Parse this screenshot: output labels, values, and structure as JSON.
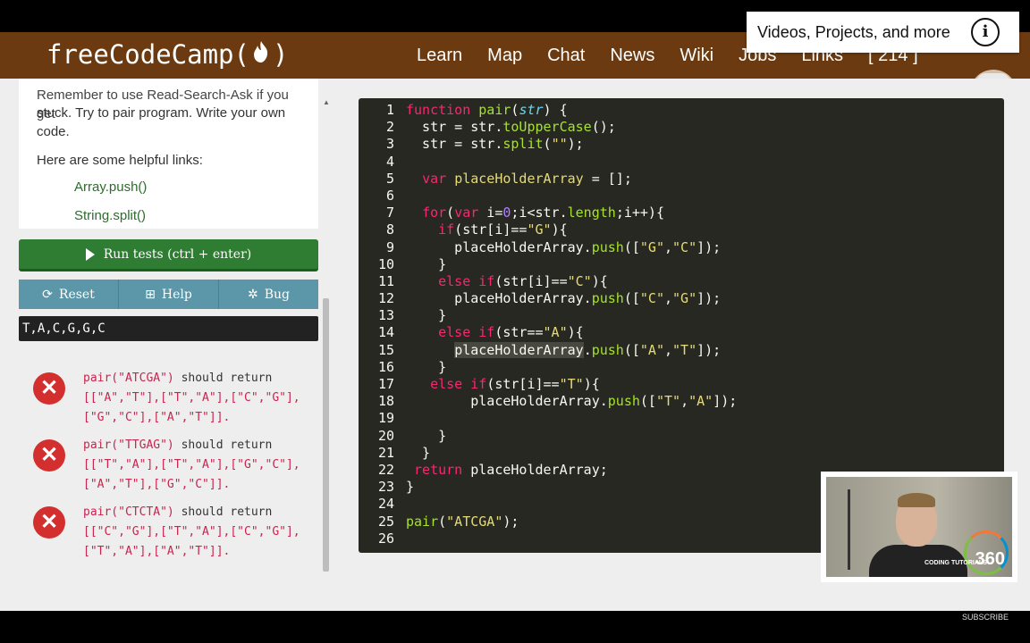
{
  "navbar": {
    "brand": "freeCodeCamp(",
    "brand_close": ")",
    "links": [
      "Learn",
      "Map",
      "Chat",
      "News",
      "Wiki",
      "Jobs",
      "Links",
      "[ 214 ]"
    ]
  },
  "overlay": {
    "text": "Videos, Projects, and more",
    "info_icon": "i"
  },
  "description": {
    "partial_top": "Remember to use Read-Search-Ask if you get",
    "line1": "stuck. Try to pair program. Write your own",
    "line2": "code.",
    "helpful": "Here are some helpful links:",
    "links": [
      "Array.push()",
      "String.split()"
    ]
  },
  "buttons": {
    "run": "Run tests (ctrl + enter)",
    "reset": "Reset",
    "help": "Help",
    "bug": "Bug"
  },
  "output": "T,A,C,G,G,C",
  "tests": [
    {
      "call": "pair(\"ATCGA\")",
      "text": " should return",
      "line2": "[[\"A\",\"T\"],[\"T\",\"A\"],[\"C\",\"G\"],",
      "line3": "[\"G\",\"C\"],[\"A\",\"T\"]]."
    },
    {
      "call": "pair(\"TTGAG\")",
      "text": " should return",
      "line2": "[[\"T\",\"A\"],[\"T\",\"A\"],[\"G\",\"C\"],",
      "line3": "[\"A\",\"T\"],[\"G\",\"C\"]]."
    },
    {
      "call": "pair(\"CTCTA\")",
      "text": " should return",
      "line2": "[[\"C\",\"G\"],[\"T\",\"A\"],[\"C\",\"G\"],",
      "line3": "[\"T\",\"A\"],[\"A\",\"T\"]]."
    }
  ],
  "line_numbers": [
    "1",
    "2",
    "3",
    "4",
    "5",
    "6",
    "7",
    "8",
    "9",
    "10",
    "11",
    "12",
    "13",
    "14",
    "15",
    "16",
    "17",
    "18",
    "19",
    "20",
    "21",
    "22",
    "23",
    "24",
    "25",
    "26"
  ],
  "webcam": {
    "brand": "CODING TUTORIALS",
    "number": "360"
  },
  "footer": {
    "subscribe": "SUBSCRIBE"
  },
  "colors": {
    "navbar": "#6b3a10",
    "run": "#2e7d32",
    "secondary": "#5b97a8",
    "editor_bg": "#272822",
    "error": "#d32f2f"
  }
}
